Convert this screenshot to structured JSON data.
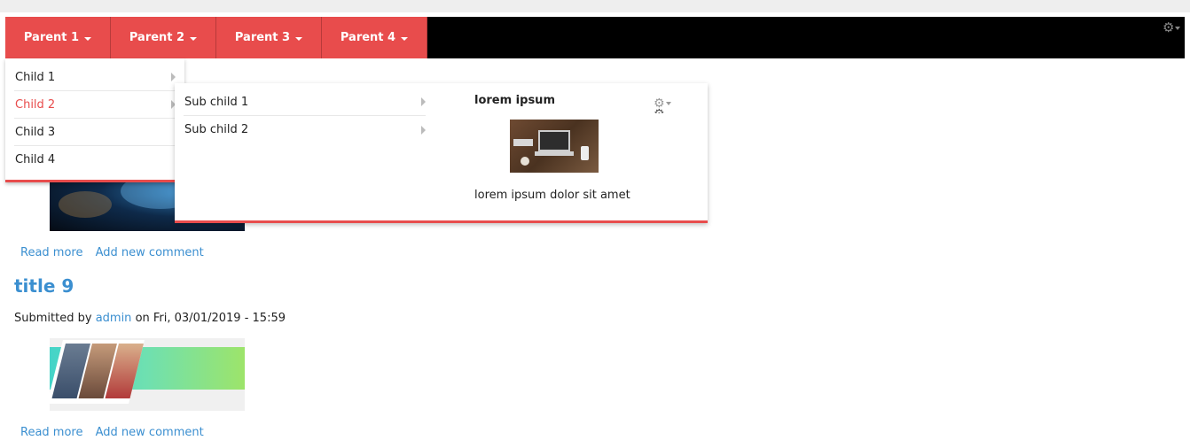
{
  "navbar": {
    "items": [
      {
        "label": "Parent 1"
      },
      {
        "label": "Parent 2"
      },
      {
        "label": "Parent 3"
      },
      {
        "label": "Parent 4"
      }
    ]
  },
  "dropdown": {
    "children": [
      {
        "label": "Child 1"
      },
      {
        "label": "Child 2"
      },
      {
        "label": "Child 3"
      },
      {
        "label": "Child 4"
      }
    ],
    "active_child": "Child 2"
  },
  "submenu": {
    "items": [
      {
        "label": "Sub child 1"
      },
      {
        "label": "Sub child 2"
      }
    ],
    "promo": {
      "title": "lorem ipsum",
      "text": "lorem ipsum dolor sit amet"
    }
  },
  "articles": [
    {
      "read_more": "Read more",
      "add_comment": "Add new comment"
    },
    {
      "title": "title 9",
      "submitted_prefix": "Submitted by",
      "author": "admin",
      "date_text": "on Fri, 03/01/2019 - 15:59",
      "read_more": "Read more",
      "add_comment": "Add new comment"
    }
  ],
  "icons": {
    "gear": "gear-icon",
    "submenu_arrow": "chevron-right-icon",
    "caret": "caret-down-icon"
  },
  "colors": {
    "accent": "#e84c4c",
    "navbar_bg": "#000000",
    "link": "#3b8fd0"
  }
}
